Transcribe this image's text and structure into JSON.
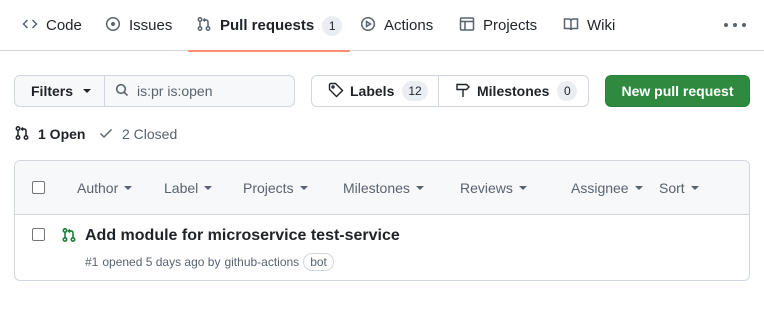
{
  "nav": {
    "tabs": [
      {
        "label": "Code",
        "icon": "code-icon"
      },
      {
        "label": "Issues",
        "icon": "issue-opened-icon"
      },
      {
        "label": "Pull requests",
        "icon": "git-pull-request-icon",
        "count": "1",
        "active": true
      },
      {
        "label": "Actions",
        "icon": "play-icon"
      },
      {
        "label": "Projects",
        "icon": "table-icon"
      },
      {
        "label": "Wiki",
        "icon": "book-icon"
      }
    ],
    "more_icon": "kebab-horizontal-icon"
  },
  "toolbar": {
    "filters_label": "Filters",
    "search_value": "is:pr is:open",
    "labels_label": "Labels",
    "labels_count": "12",
    "milestones_label": "Milestones",
    "milestones_count": "0",
    "new_pr_label": "New pull request"
  },
  "states": {
    "open_label": "1 Open",
    "closed_label": "2 Closed"
  },
  "table": {
    "filters": [
      "Author",
      "Label",
      "Projects",
      "Milestones",
      "Reviews",
      "Assignee",
      "Sort"
    ],
    "rows": [
      {
        "title": "Add module for microservice test-service",
        "number": "#1",
        "opened_text": "opened 5 days ago by",
        "author": "github-actions",
        "badge": "bot"
      }
    ]
  },
  "colors": {
    "accent_underline": "#fd8c73",
    "primary_button": "#2f8a3f",
    "open_icon": "#1a7f37"
  }
}
